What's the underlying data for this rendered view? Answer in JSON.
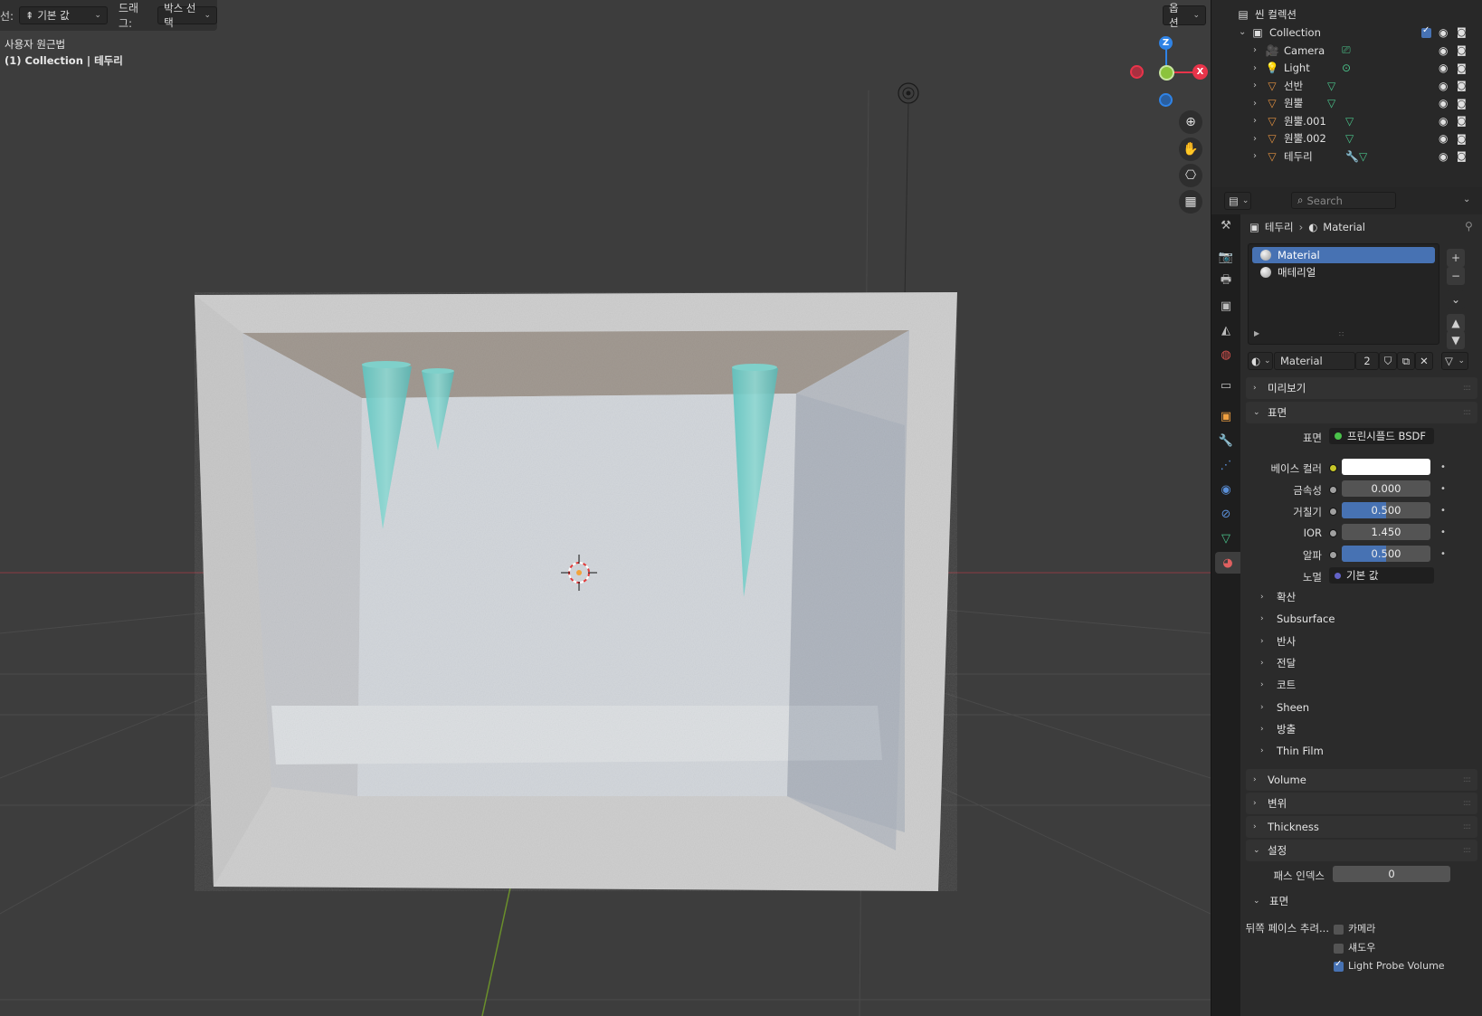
{
  "viewport": {
    "header": {
      "select_label": "선:",
      "select_value": "기본 값",
      "drag_label": "드래그:",
      "drag_value": "박스 선택",
      "options_label": "옵션"
    },
    "info": {
      "line1": "사용자 원근법",
      "line2": "(1) Collection | 테두리"
    },
    "gizmo": {
      "z": "Z",
      "x": "X",
      "colors": {
        "x": "#e8344a",
        "y": "#8bc33c",
        "z": "#2f83e6"
      }
    },
    "nav_icons": [
      "zoom-icon",
      "hand-pan-icon",
      "camera-view-icon",
      "grid-ortho-icon"
    ]
  },
  "outliner": {
    "scene_collection": "씬 컬렉션",
    "collection": "Collection",
    "items": [
      {
        "name": "Camera",
        "icon": "camera-icon",
        "data_icon": "camera-data-icon"
      },
      {
        "name": "Light",
        "icon": "light-icon",
        "data_icon": "light-data-icon"
      },
      {
        "name": "선반",
        "icon": "mesh-icon",
        "data_icon": "mesh-data-icon"
      },
      {
        "name": "원뿔",
        "icon": "mesh-icon",
        "data_icon": "mesh-data-icon"
      },
      {
        "name": "원뿔.001",
        "icon": "mesh-icon",
        "data_icon": "mesh-data-icon"
      },
      {
        "name": "원뿔.002",
        "icon": "mesh-icon",
        "data_icon": "mesh-data-icon"
      },
      {
        "name": "테두리",
        "icon": "mesh-icon",
        "data_icon": "modifier-mesh-icon"
      }
    ]
  },
  "properties": {
    "search_placeholder": "Search",
    "breadcrumb": {
      "object": "테두리",
      "material": "Material"
    },
    "slots": [
      {
        "name": "Material",
        "selected": true
      },
      {
        "name": "매테리얼",
        "selected": false
      }
    ],
    "material_name": "Material",
    "user_count": "2",
    "sections": {
      "preview": "미리보기",
      "surface": "표면",
      "volume": "Volume",
      "displacement": "변위",
      "thickness": "Thickness",
      "settings": "설정"
    },
    "surface": {
      "surface_label": "표면",
      "surface_value": "프린시플드 BSDF",
      "base_color_label": "베이스 컬러",
      "base_color": "#ffffff",
      "metallic_label": "금속성",
      "metallic": "0.000",
      "roughness_label": "거칠기",
      "roughness": "0.500",
      "ior_label": "IOR",
      "ior": "1.450",
      "alpha_label": "알파",
      "alpha": "0.500",
      "normal_label": "노멀",
      "normal_value": "기본 값"
    },
    "subpanels": [
      "확산",
      "Subsurface",
      "반사",
      "전달",
      "코트",
      "Sheen",
      "방출",
      "Thin Film"
    ],
    "settings": {
      "pass_index_label": "패스 인덱스",
      "pass_index": "0",
      "surface_sub": "표면",
      "backface_label": "뒤쪽 페이스 추려...",
      "camera_label": "카메라",
      "camera_checked": false,
      "shadow_label": "섀도우",
      "shadow_checked": false,
      "probe_label": "Light Probe Volume",
      "probe_checked": true
    }
  }
}
